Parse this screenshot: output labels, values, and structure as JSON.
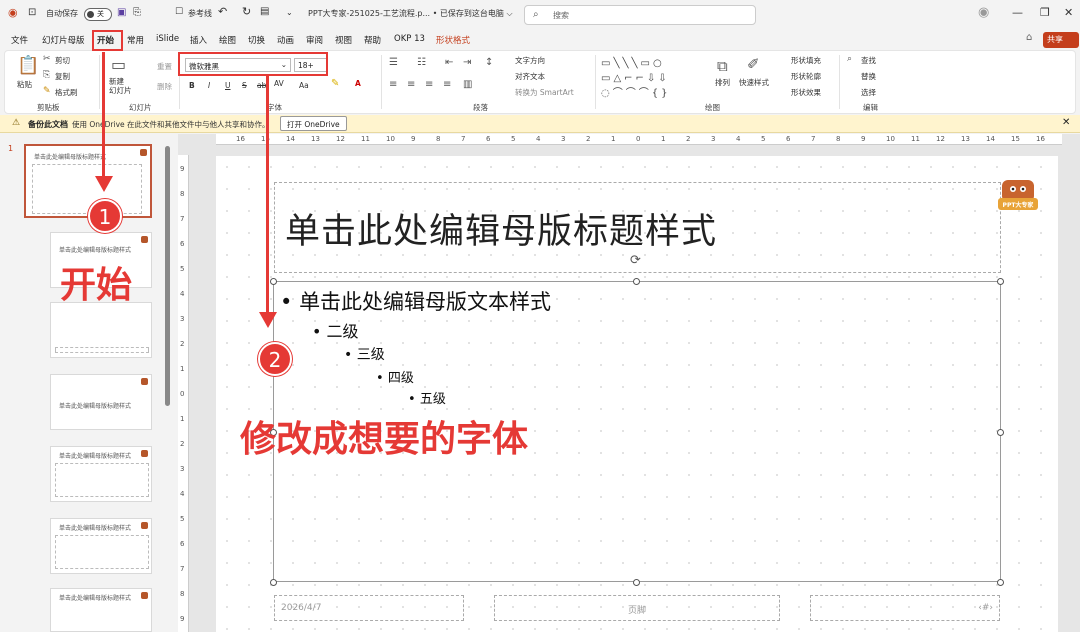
{
  "titlebar": {
    "autosave": "自动保存",
    "toggle": "关",
    "ref_lines": "参考线",
    "doc_title": "PPT大专家-251025-工艺流程.p...  • 已保存到这台电脑 ⌵",
    "search_placeholder": "搜索"
  },
  "tabs": [
    "文件",
    "幻灯片母版",
    "开始",
    "常用",
    "iSlide",
    "插入",
    "绘图",
    "切换",
    "动画",
    "审阅",
    "视图",
    "帮助",
    "OKP 13",
    "形状格式"
  ],
  "share": "共享",
  "ribbon": {
    "paste": "粘贴",
    "cut": "剪切",
    "copy": "复制",
    "format_painter": "格式刷",
    "clipboard": "剪贴板",
    "new_slide": "新建\n幻灯片",
    "reset": "重置",
    "delete": "删除",
    "slides_group": "幻灯片",
    "font_name": "微软雅黑",
    "font_size": "18+",
    "font_group": "字体",
    "bold": "B",
    "italic": "I",
    "underline": "U",
    "strike": "S",
    "shadow": "ab",
    "spacing": "AV",
    "case": "Aa",
    "text_dir": "文字方向",
    "align_text": "对齐文本",
    "smartart": "转换为 SmartArt",
    "para_group": "段落",
    "arrange": "排列",
    "quick_styles": "快速样式",
    "shape_fill": "形状填充",
    "shape_outline": "形状轮廓",
    "shape_effects": "形状效果",
    "drawing_group": "绘图",
    "find": "查找",
    "replace": "替换",
    "select": "选择",
    "edit_group": "编辑"
  },
  "notice": {
    "bold": "备份此文档",
    "text": "使用 OneDrive 在此文件和其他文件中与他人共享和协作。",
    "button": "打开 OneDrive"
  },
  "thumbs": {
    "num": "1",
    "t1": "单击此处编辑母版标题样式",
    "t2": "单击此处编辑母版标题样式",
    "t4": "单击此处编辑母版标题样式",
    "t5": "单击此处编辑母版标题样式",
    "t6": "单击此处编辑母版标题样式",
    "t7": "单击此处编辑母版标题样式"
  },
  "ruler_h": [
    "16",
    "15",
    "14",
    "13",
    "12",
    "11",
    "10",
    "9",
    "8",
    "7",
    "6",
    "5",
    "4",
    "3",
    "2",
    "1",
    "0",
    "1",
    "2",
    "3",
    "4",
    "5",
    "6",
    "7",
    "8",
    "9",
    "10",
    "11",
    "12",
    "13",
    "14",
    "15",
    "16"
  ],
  "ruler_v": [
    "9",
    "8",
    "7",
    "6",
    "5",
    "4",
    "3",
    "2",
    "1",
    "0",
    "1",
    "2",
    "3",
    "4",
    "5",
    "6",
    "7",
    "8",
    "9"
  ],
  "slide": {
    "title": "单击此处编辑母版标题样式",
    "l1": "单击此处编辑母版文本样式",
    "l2": "二级",
    "l3": "三级",
    "l4": "四级",
    "l5": "五级",
    "date": "2026/4/7",
    "footer": "页脚",
    "num": "‹#›",
    "brand": "PPT大专家"
  },
  "annotations": {
    "b1": "1",
    "b2": "2",
    "a1": "开始",
    "a2": "修改成想要的字体"
  },
  "colors": {
    "accent": "#c43e1c",
    "annotation": "#e53935",
    "notice_bg": "#fff4ce"
  }
}
